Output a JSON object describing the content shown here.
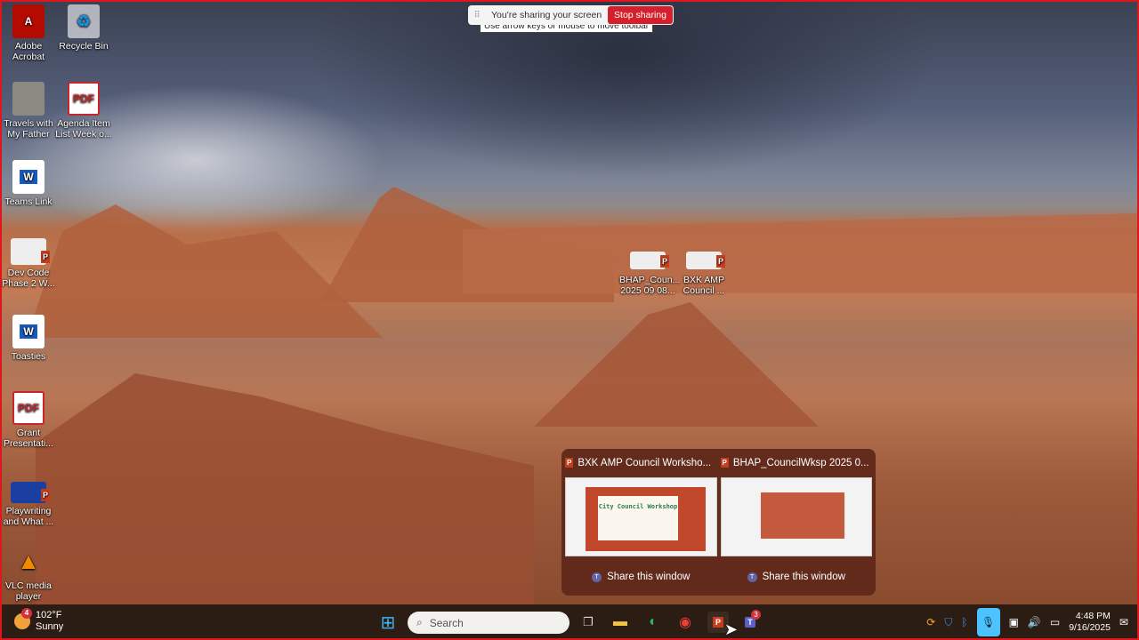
{
  "share_toolbar": {
    "message": "You're sharing your screen",
    "stop_label": "Stop sharing",
    "tooltip": "Use arrow keys or mouse to move toolbar"
  },
  "desktop_icons": [
    {
      "label": "Adobe Acrobat",
      "type": "acrobat"
    },
    {
      "label": "Recycle Bin",
      "type": "recycle"
    },
    {
      "label": "Travels with My Father",
      "type": "photo"
    },
    {
      "label": "Agenda Item List Week o...",
      "type": "pdf"
    },
    {
      "label": "Teams Link",
      "type": "word"
    },
    {
      "label": "Dev Code Phase 2 W...",
      "type": "ppt"
    },
    {
      "label": "Toasties",
      "type": "word"
    },
    {
      "label": "Grant Presentati...",
      "type": "pdf"
    },
    {
      "label": "Playwriting and What ...",
      "type": "ppt"
    },
    {
      "label": "VLC media player",
      "type": "vlc"
    },
    {
      "label": "BHAP_Coun... 2025 09 08...",
      "type": "ppt"
    },
    {
      "label": "BXK AMP Council ...",
      "type": "ppt"
    }
  ],
  "taskbar_preview": {
    "windows": [
      {
        "title": "BXK AMP Council Worksho...",
        "slide_title": "City Council Workshop",
        "share_label": "Share this window"
      },
      {
        "title": "BHAP_CouncilWksp 2025 0...",
        "share_label": "Share this window"
      }
    ]
  },
  "taskbar": {
    "weather": {
      "temp": "102°F",
      "condition": "Sunny",
      "badge": "4"
    },
    "search_placeholder": "Search",
    "teams_badge": "3",
    "clock": {
      "time": "4:48 PM",
      "date": "9/16/2025"
    }
  }
}
